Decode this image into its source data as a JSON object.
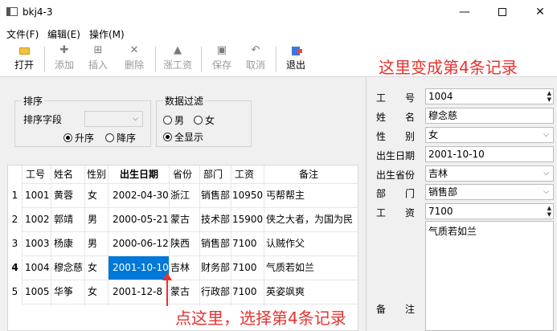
{
  "window": {
    "title": "bkj4-3",
    "minimize": "—",
    "close": "✕"
  },
  "menu": {
    "file": "文件(F)",
    "edit": "编辑(E)",
    "operate": "操作(M)"
  },
  "toolbar": {
    "open": "打开",
    "add": "添加",
    "insert": "插入",
    "delete": "删除",
    "raise": "涨工资",
    "save": "保存",
    "cancel": "取消",
    "exit": "退出"
  },
  "notes": {
    "top": "这里变成第4条记录",
    "bottom": "点这里，选择第4条记录"
  },
  "sort_group": {
    "title": "排序",
    "field_label": "排序字段",
    "field_value": "",
    "asc": "升序",
    "desc": "降序",
    "selected": "asc"
  },
  "filter_group": {
    "title": "数据过滤",
    "male": "男",
    "female": "女",
    "all": "全显示",
    "selected": "all"
  },
  "table": {
    "headers": [
      "工号",
      "姓名",
      "性别",
      "出生日期",
      "省份",
      "部门",
      "工资",
      "备注"
    ],
    "rows": [
      {
        "num": "1",
        "cells": [
          "1001",
          "黄蓉",
          "女",
          "2002-04-30",
          "浙江",
          "销售部",
          "10950",
          "丐帮帮主"
        ]
      },
      {
        "num": "2",
        "cells": [
          "1002",
          "郭靖",
          "男",
          "2000-05-21",
          "蒙古",
          "技术部",
          "15900",
          "侠之大者，为国为民"
        ]
      },
      {
        "num": "3",
        "cells": [
          "1003",
          "杨康",
          "男",
          "2000-06-12",
          "陕西",
          "销售部",
          "7100",
          "认贼作父"
        ]
      },
      {
        "num": "4",
        "cells": [
          "1004",
          "穆念慈",
          "女",
          "2001-10-10",
          "吉林",
          "财务部",
          "7100",
          "气质若如兰"
        ]
      },
      {
        "num": "5",
        "cells": [
          "1005",
          "华筝",
          "女",
          "2001-12-8",
          "蒙古",
          "行政部",
          "7100",
          "英姿飒爽"
        ]
      }
    ],
    "current_row": 4
  },
  "form": {
    "id_label": "工号",
    "id_value": "1004",
    "name_label": "姓名",
    "name_value": "穆念慈",
    "gender_label": "性别",
    "gender_value": "女",
    "birth_label": "出生日期",
    "birth_value": "2001-10-10",
    "province_label": "出生省份",
    "province_value": "吉林",
    "dept_label": "部门",
    "dept_value": "销售部",
    "salary_label": "工资",
    "salary_value": "7100",
    "memo_label": "备注",
    "memo_value": "气质若如兰"
  }
}
